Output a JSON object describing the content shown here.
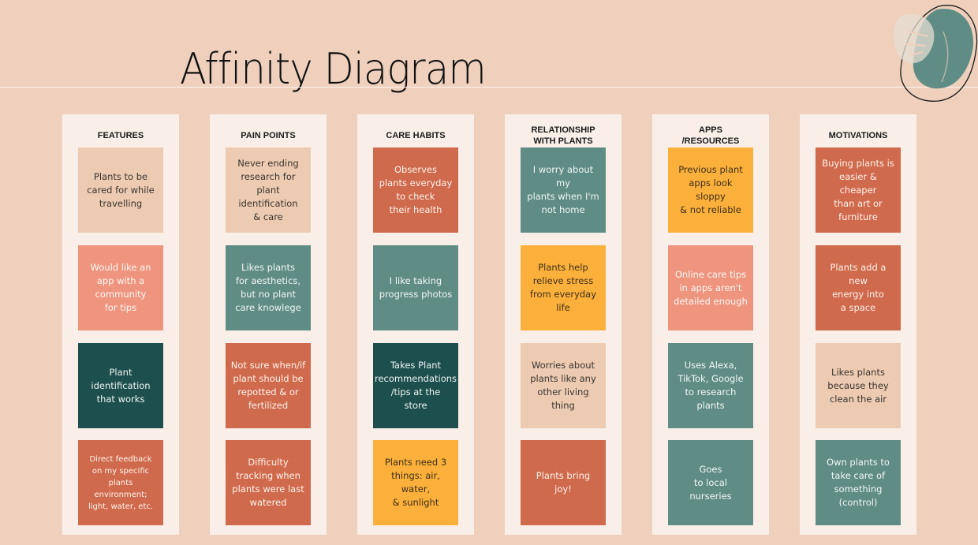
{
  "title": "Affinity Diagram",
  "colors": {
    "background": "#eed0bc",
    "column": "#f9efe8",
    "beige": "#eccbb2",
    "salmon": "#ef957f",
    "rust": "#cf6a4d",
    "teal": "#5f8d86",
    "dark_teal": "#1d4f4f",
    "yellow": "#fbb03b"
  },
  "columns": [
    {
      "header": "FEATURES",
      "notes": [
        {
          "text": "Plants to be\ncared for while\ntravelling",
          "color": "beige"
        },
        {
          "text": "Would like an\napp with a\ncommunity\nfor tips",
          "color": "salmon"
        },
        {
          "text": "Plant\nidentification\nthat works",
          "color": "dark_teal"
        },
        {
          "text": "Direct feedback\non my specific\nplants environment;\nlight, water, etc.",
          "color": "rust"
        }
      ]
    },
    {
      "header": "PAIN POINTS",
      "notes": [
        {
          "text": "Never ending\nresearch for\nplant\nidentification\n& care",
          "color": "beige"
        },
        {
          "text": "Likes plants\nfor aesthetics,\nbut no plant\ncare knowlege",
          "color": "teal"
        },
        {
          "text": "Not sure when/if\nplant should be\nrepotted & or\nfertilized",
          "color": "rust"
        },
        {
          "text": "Difficulty\ntracking when\nplants were last\nwatered",
          "color": "rust"
        }
      ]
    },
    {
      "header": "CARE HABITS",
      "notes": [
        {
          "text": "Observes\nplants everyday\nto check\ntheir health",
          "color": "rust"
        },
        {
          "text": "I like taking\nprogress photos",
          "color": "teal"
        },
        {
          "text": "Takes Plant\nrecommendations\n/tips at the\nstore",
          "color": "dark_teal"
        },
        {
          "text": "Plants need 3\nthings: air, water,\n& sunlight",
          "color": "yellow"
        }
      ]
    },
    {
      "header": "RELATIONSHIP\nWITH PLANTS",
      "notes": [
        {
          "text": "I worry about my\nplants when I'm\nnot home",
          "color": "teal"
        },
        {
          "text": "Plants help\nrelieve stress\nfrom everyday\nlife",
          "color": "yellow"
        },
        {
          "text": "Worries about\nplants like any\nother living\nthing",
          "color": "beige"
        },
        {
          "text": "Plants bring\njoy!",
          "color": "rust"
        }
      ]
    },
    {
      "header": "APPS\n/RESOURCES",
      "notes": [
        {
          "text": "Previous plant\napps look sloppy\n& not reliable",
          "color": "yellow"
        },
        {
          "text": "Online care tips\nin apps aren't\ndetailed enough",
          "color": "salmon"
        },
        {
          "text": "Uses Alexa,\nTikTok, Google\nto research\nplants",
          "color": "teal"
        },
        {
          "text": "Goes\nto local nurseries",
          "color": "teal"
        }
      ]
    },
    {
      "header": "MOTIVATIONS",
      "notes": [
        {
          "text": "Buying plants is\neasier & cheaper\nthan art or\nfurniture",
          "color": "rust"
        },
        {
          "text": "Plants add a new\nenergy into\na space",
          "color": "rust"
        },
        {
          "text": "Likes plants\nbecause they\nclean the air",
          "color": "beige"
        },
        {
          "text": "Own plants to\ntake care of\nsomething\n(control)",
          "color": "teal"
        }
      ]
    }
  ]
}
